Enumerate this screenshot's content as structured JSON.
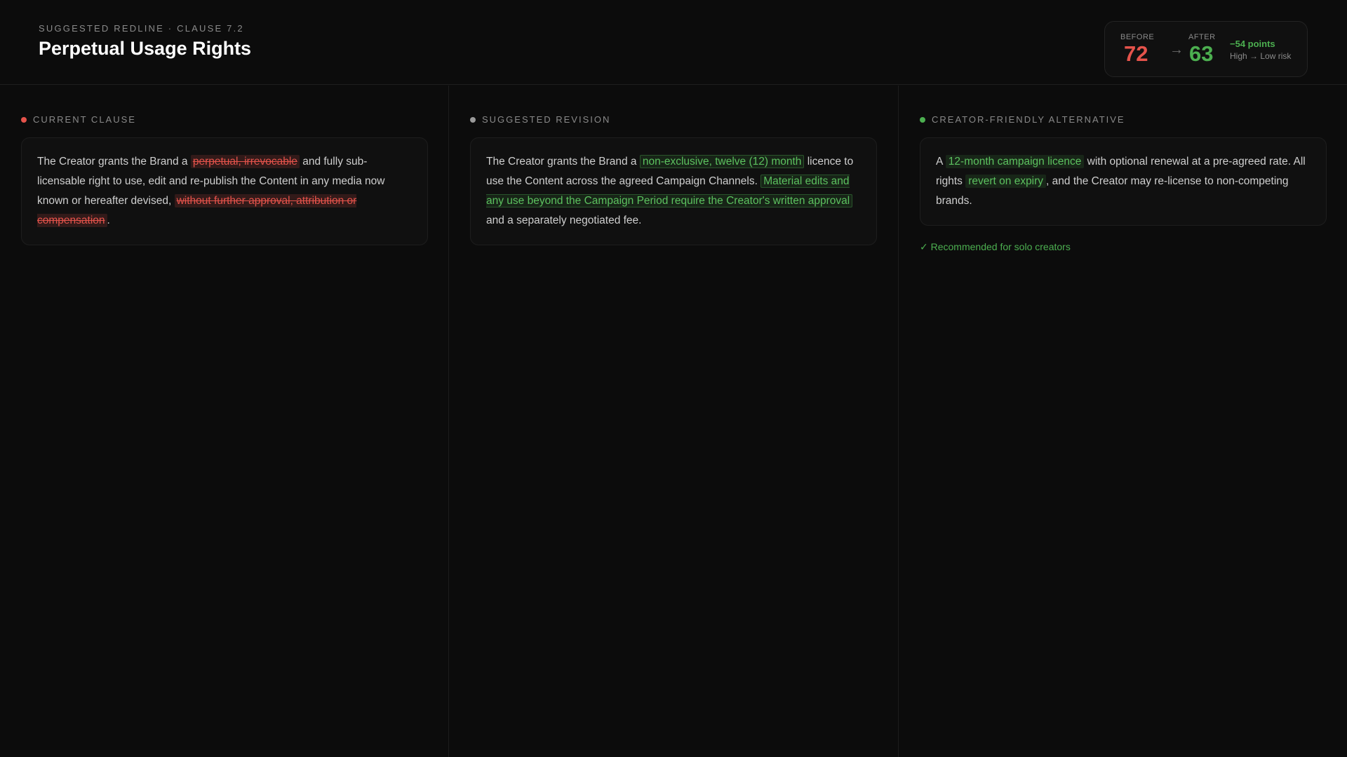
{
  "header": {
    "eyebrow": "SUGGESTED REDLINE · CLAUSE 7.2",
    "title": "Perpetual Usage Rights"
  },
  "score": {
    "before_label": "BEFORE",
    "before_value": "72",
    "arrow": "→",
    "after_label": "AFTER",
    "after_value": "63",
    "delta": "−54 points",
    "band": "High → Low risk"
  },
  "colors": {
    "risk_red": "#e5534b",
    "safe_green": "#4caf50",
    "neutral_dot": "#9a9a9a"
  },
  "columns": {
    "current": {
      "heading": "CURRENT CLAUSE",
      "p1": "The Creator grants the Brand a ",
      "strike1": "perpetual, irrevocable",
      "p2": " and fully sub-licensable right to use, edit and re-publish the Content in any media now known or hereafter devised, ",
      "strike2": "without further approval, attribution or compensation",
      "p3": "."
    },
    "revision": {
      "heading": "SUGGESTED REVISION",
      "p1": "The Creator grants the Brand a ",
      "add1": "non-exclusive, twelve (12) month",
      "p2": " licence to use the Content across the agreed Campaign Channels. ",
      "add2": "Material edits and any use beyond the Campaign Period require the Creator's written approval",
      "p3": " and a separately negotiated fee."
    },
    "alternative": {
      "heading": "CREATOR-FRIENDLY ALTERNATIVE",
      "p1": "A ",
      "add1": "12-month campaign licence",
      "p2": " with optional renewal at a pre-agreed rate. All rights ",
      "add2": "revert on expiry",
      "p3": ", and the Creator may re-license to non-competing brands.",
      "recommendation": "✓ Recommended for solo creators"
    }
  }
}
